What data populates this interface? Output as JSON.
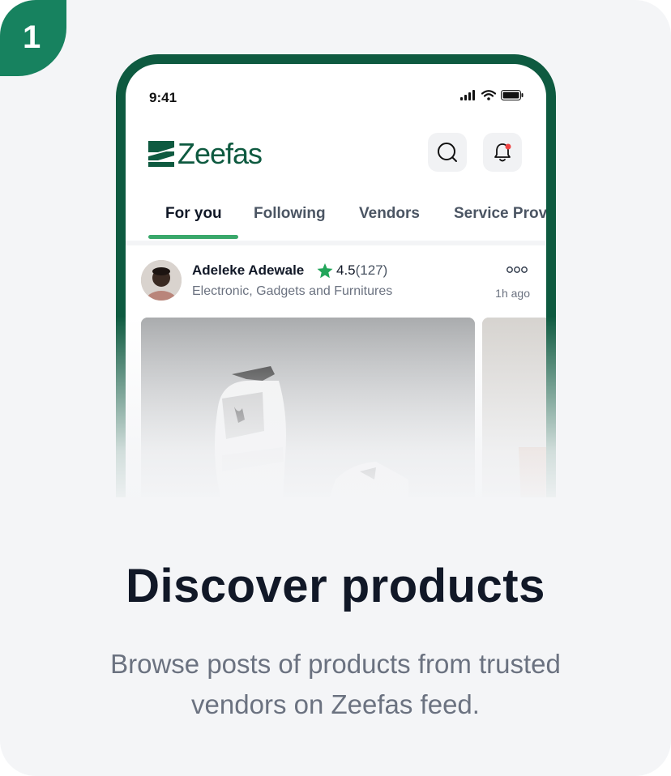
{
  "step": {
    "number": "1"
  },
  "phone": {
    "status_time": "9:41",
    "app_name": "Zeefas",
    "tabs": [
      {
        "label": "For you",
        "active": true
      },
      {
        "label": "Following"
      },
      {
        "label": "Vendors"
      },
      {
        "label": "Service Prov"
      }
    ],
    "post": {
      "vendor_name": "Adeleke Adewale",
      "rating": "4.5",
      "rating_count": "(127)",
      "category": "Electronic, Gadgets and Furnitures",
      "time": "1h ago"
    }
  },
  "headline": "Discover products",
  "subtext": "Browse posts of products from trusted vendors on Zeefas feed.",
  "colors": {
    "brand": "#0e5a40",
    "badge": "#17825f",
    "active_tab_underline": "#3aa86b",
    "star": "#22a55a",
    "notification_dot": "#ef4444"
  },
  "icons": [
    "signal-icon",
    "wifi-icon",
    "battery-icon",
    "search-icon",
    "bell-icon",
    "star-icon",
    "more-icon"
  ]
}
